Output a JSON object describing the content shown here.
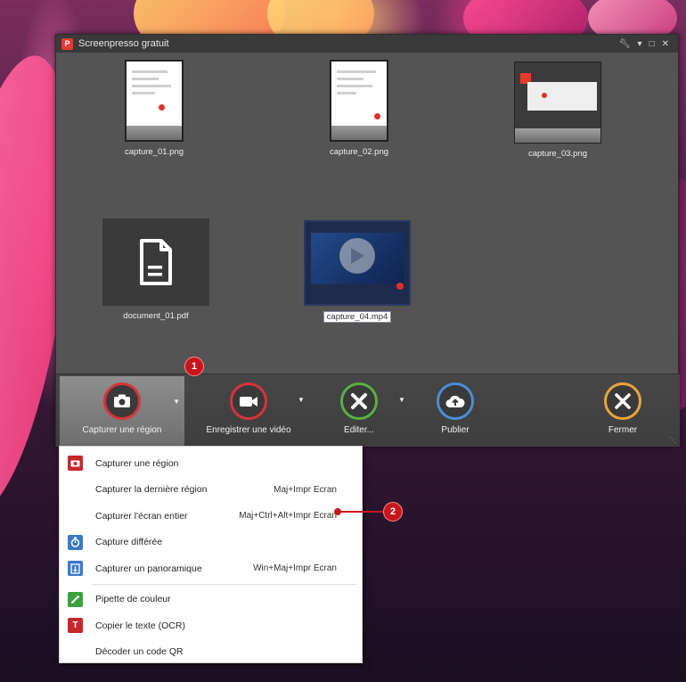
{
  "window": {
    "title": "Screenpresso gratuit",
    "logo_letter": "P"
  },
  "files": [
    {
      "name": "capture_01.png",
      "kind": "screenshot"
    },
    {
      "name": "capture_02.png",
      "kind": "screenshot"
    },
    {
      "name": "capture_03.png",
      "kind": "screenshot"
    },
    {
      "name": "document_01.pdf",
      "kind": "pdf"
    },
    {
      "name": "capture_04.mp4",
      "kind": "video",
      "selected": true
    }
  ],
  "toolbar": {
    "capture_region": "Capturer une région",
    "record_video": "Enregistrer une vidéo",
    "edit": "Editer...",
    "publish": "Publier",
    "close": "Fermer"
  },
  "callouts": {
    "first": "1",
    "second": "2"
  },
  "menu": {
    "items": [
      {
        "label": "Capturer une région",
        "shortcut": "",
        "icon": "camera-icon",
        "icon_color": "#c8262c"
      },
      {
        "label": "Capturer la dernière région",
        "shortcut": "Maj+Impr Ecran",
        "icon": "",
        "icon_color": ""
      },
      {
        "label": "Capturer l'écran entier",
        "shortcut": "Maj+Ctrl+Alt+Impr Ecran",
        "icon": "",
        "icon_color": ""
      },
      {
        "label": "Capture différée",
        "shortcut": "",
        "icon": "timer-icon",
        "icon_color": "#3d78c8"
      },
      {
        "label": "Capturer un panoramique",
        "shortcut": "Win+Maj+Impr Ecran",
        "icon": "panorama-icon",
        "icon_color": "#3d78c8"
      },
      {
        "label": "Pipette de couleur",
        "shortcut": "",
        "icon": "eyedropper-icon",
        "icon_color": "#3aa13e"
      },
      {
        "label": "Copier le texte (OCR)",
        "shortcut": "",
        "icon": "text-ocr-icon",
        "icon_color": "#c8262c"
      },
      {
        "label": "Décoder un code QR",
        "shortcut": "",
        "icon": "",
        "icon_color": ""
      }
    ]
  },
  "colors": {
    "accent_red": "#c8161d",
    "record_red": "#d8333d",
    "edit_green": "#59b043",
    "publish_blue": "#4b8ed6",
    "close_orange": "#e9a53a"
  }
}
